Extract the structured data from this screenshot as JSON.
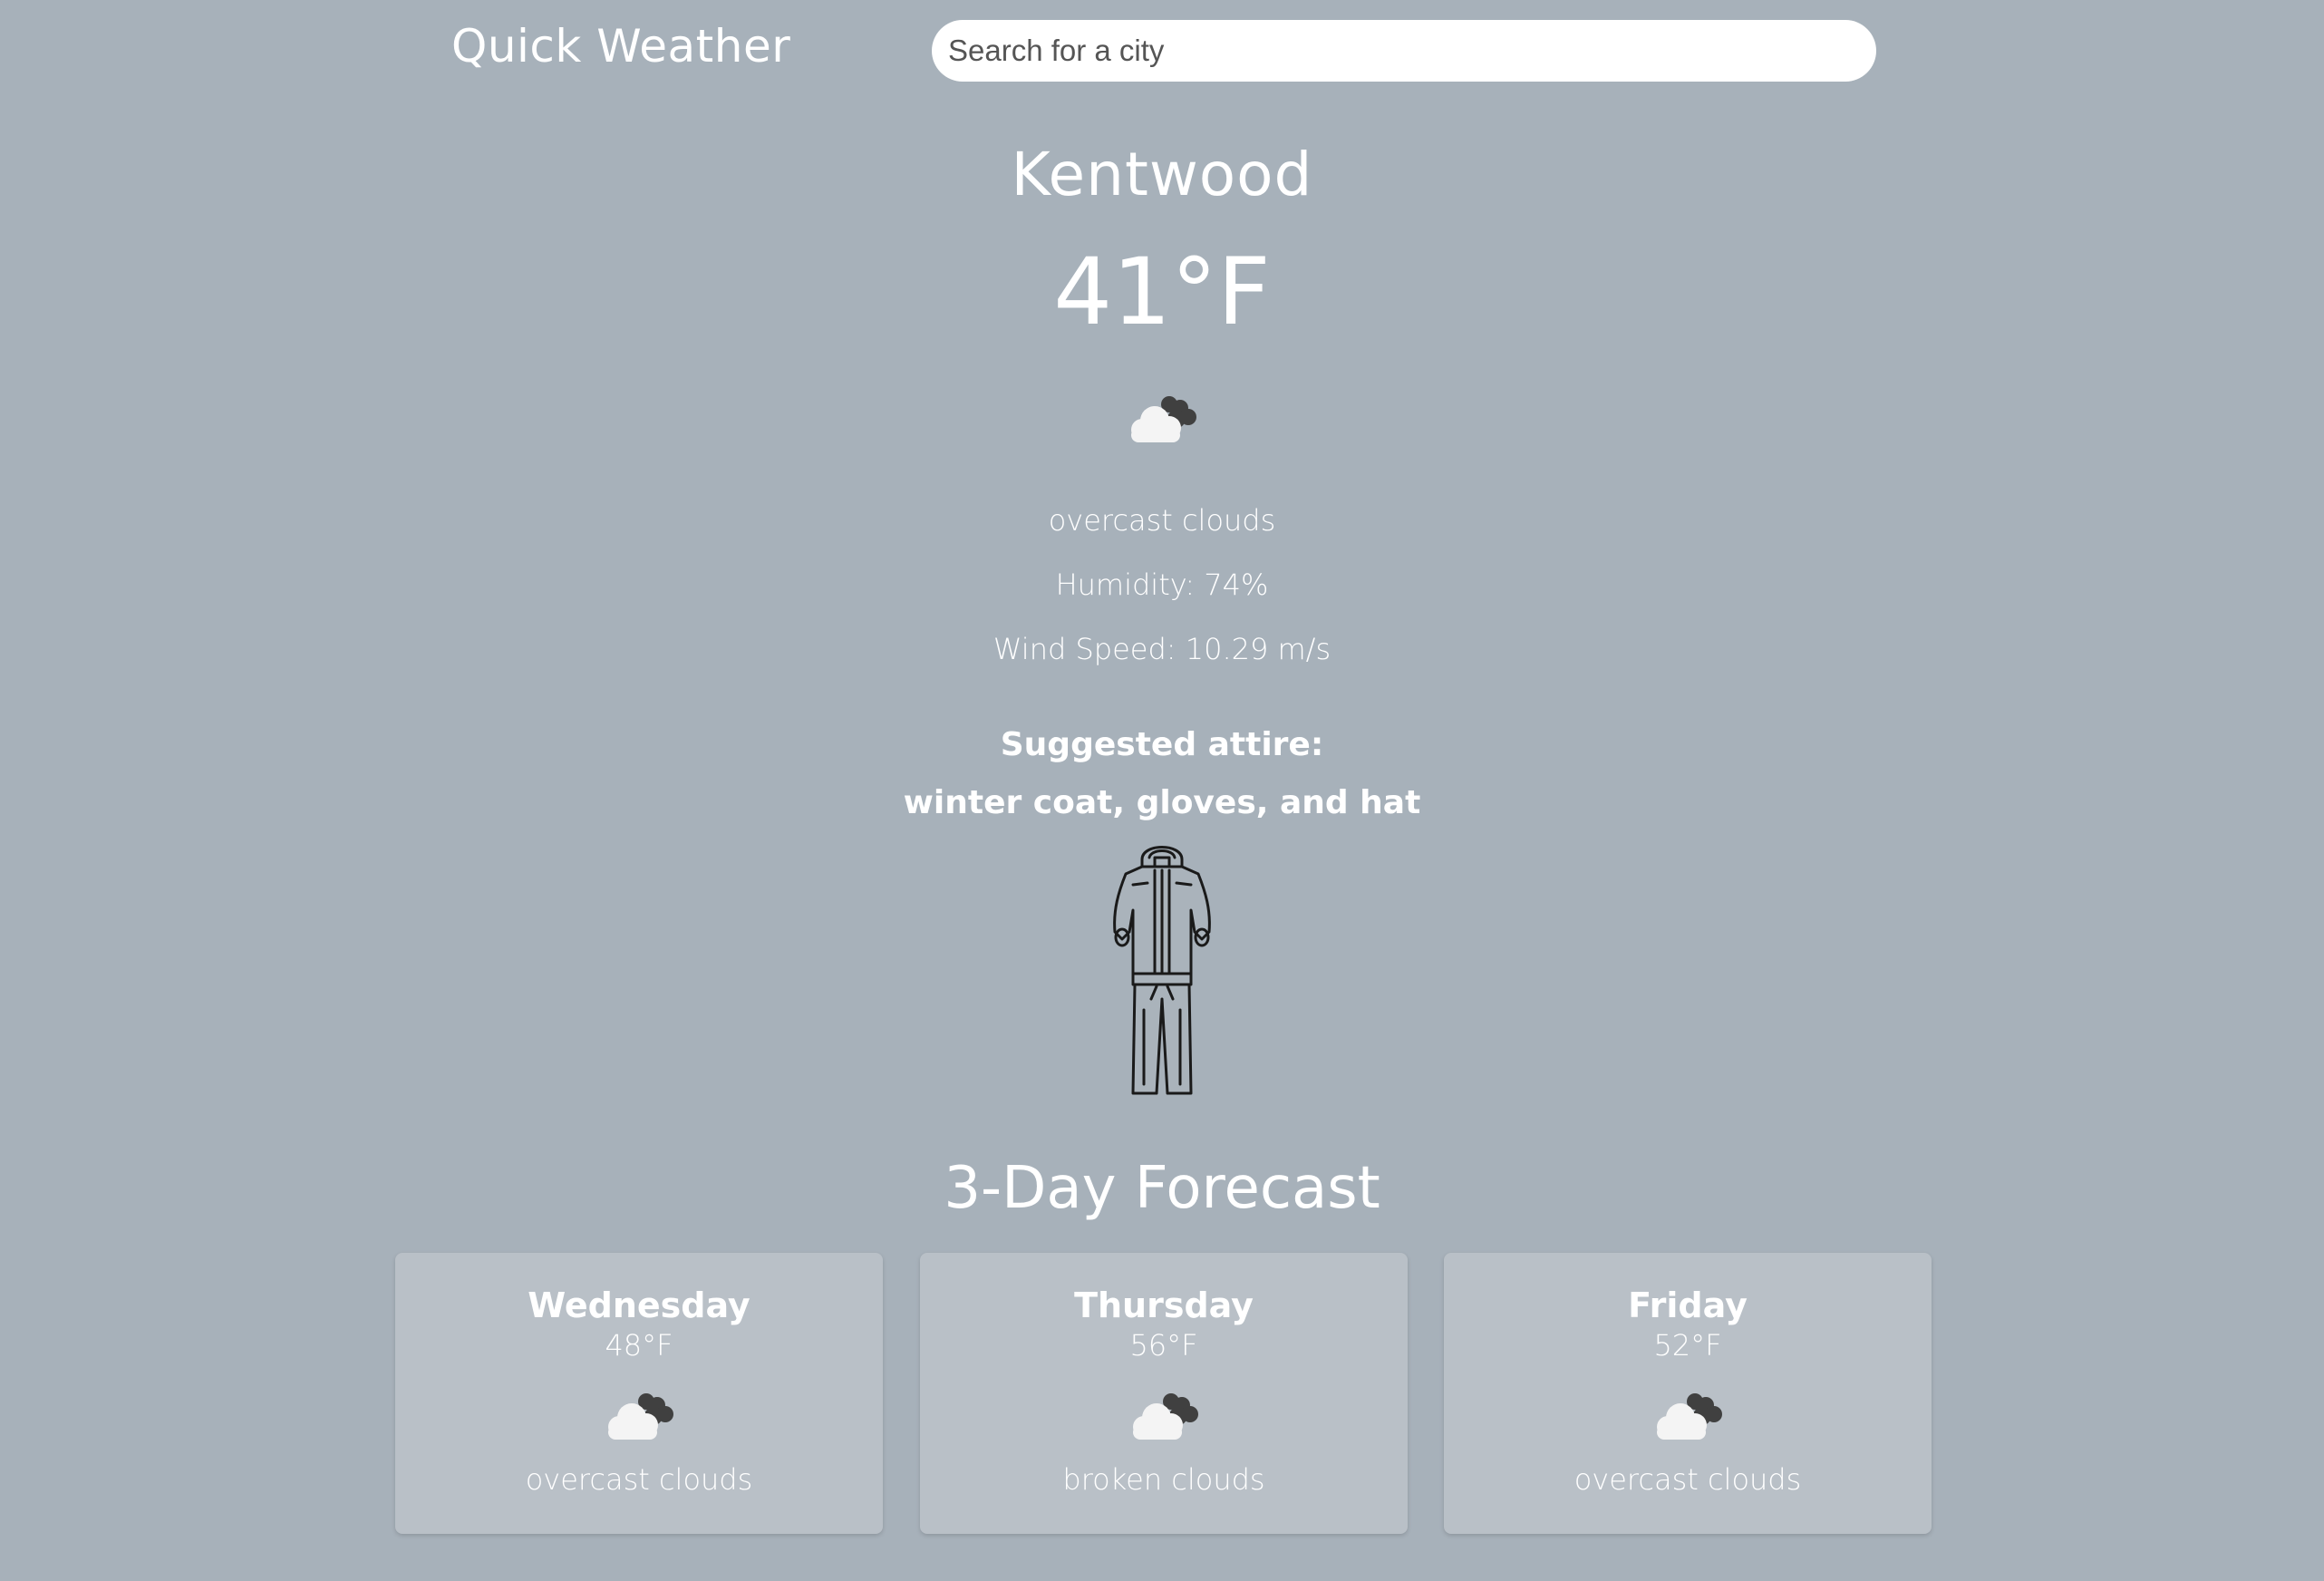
{
  "header": {
    "title": "Quick Weather",
    "search_placeholder": "Search for a city"
  },
  "current": {
    "city": "Kentwood",
    "temperature": "41°F",
    "icon": "overcast-clouds-icon",
    "description": "overcast clouds",
    "humidity": "Humidity: 74%",
    "wind_speed": "Wind Speed: 10.29 m/s",
    "attire_heading": "Suggested attire:",
    "attire_text": "winter coat, gloves, and hat",
    "attire_icon": "winter-outfit-icon"
  },
  "forecast": {
    "heading": "3-Day Forecast",
    "days": [
      {
        "day": "Wednesday",
        "temp": "48°F",
        "icon": "overcast-clouds-icon",
        "description": "overcast clouds"
      },
      {
        "day": "Thursday",
        "temp": "56°F",
        "icon": "broken-clouds-icon",
        "description": "broken clouds"
      },
      {
        "day": "Friday",
        "temp": "52°F",
        "icon": "overcast-clouds-icon",
        "description": "overcast clouds"
      }
    ]
  },
  "colors": {
    "background": "#a7b1ba",
    "card": "#b9c0c7",
    "text": "#ffffff"
  }
}
